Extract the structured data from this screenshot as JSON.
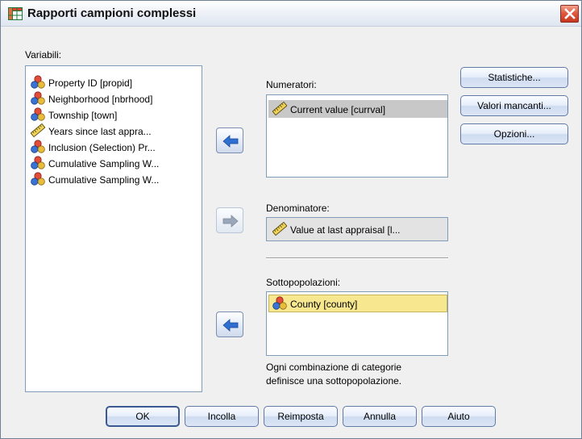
{
  "window": {
    "title": "Rapporti campioni complessi",
    "close_glyph": "X"
  },
  "variables": {
    "label": "Variabili:",
    "items": [
      {
        "label": "Property ID [propid]",
        "icon": "nominal-icon"
      },
      {
        "label": "Neighborhood [nbrhood]",
        "icon": "nominal-icon"
      },
      {
        "label": "Township [town]",
        "icon": "nominal-icon"
      },
      {
        "label": "Years since last appra...",
        "icon": "scale-ruler-icon"
      },
      {
        "label": "Inclusion (Selection) Pr...",
        "icon": "nominal-icon"
      },
      {
        "label": "Cumulative Sampling W...",
        "icon": "nominal-icon"
      },
      {
        "label": "Cumulative Sampling W...",
        "icon": "nominal-icon"
      }
    ]
  },
  "numerator": {
    "label": "Numeratori:",
    "items": [
      {
        "label": "Current value [currval]",
        "icon": "scale-ruler-icon"
      }
    ]
  },
  "denominator": {
    "label": "Denominatore:",
    "value": "Value at last appraisal [l...",
    "icon": "scale-ruler-icon"
  },
  "subpopulations": {
    "label": "Sottopopolazioni:",
    "items": [
      {
        "label": "County [county]",
        "icon": "nominal-icon"
      }
    ],
    "note_line1": "Ogni combinazione di categorie",
    "note_line2": "definisce una sottopopolazione."
  },
  "side_buttons": {
    "statistics": "Statistiche...",
    "missing": "Valori mancanti...",
    "options": "Opzioni..."
  },
  "bottom_buttons": {
    "ok": "OK",
    "paste": "Incolla",
    "reset": "Reimposta",
    "cancel": "Annulla",
    "help": "Aiuto"
  },
  "colors": {
    "selection_gray": "#c8c8c8",
    "selection_yellow": "#f7e890",
    "list_border": "#7f9db9",
    "arrow_blue": "#2f6fcf"
  }
}
